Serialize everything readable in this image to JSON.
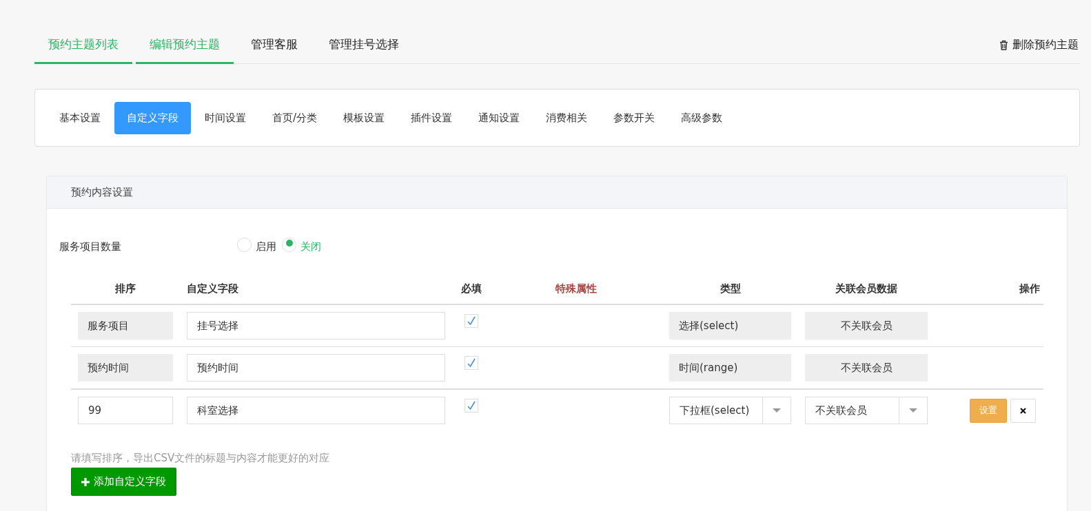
{
  "top_tabs": [
    {
      "label": "预约主题列表",
      "selected": true
    },
    {
      "label": "编辑预约主题",
      "selected": true
    },
    {
      "label": "管理客服",
      "selected": false
    },
    {
      "label": "管理挂号选择",
      "selected": false
    }
  ],
  "delete_link": "删除预约主题",
  "sub_tabs": [
    {
      "label": "基本设置",
      "selected": false
    },
    {
      "label": "自定义字段",
      "selected": true
    },
    {
      "label": "时间设置",
      "selected": false
    },
    {
      "label": "首页/分类",
      "selected": false
    },
    {
      "label": "模板设置",
      "selected": false
    },
    {
      "label": "插件设置",
      "selected": false
    },
    {
      "label": "通知设置",
      "selected": false
    },
    {
      "label": "消费相关",
      "selected": false
    },
    {
      "label": "参数开关",
      "selected": false
    },
    {
      "label": "高级参数",
      "selected": false
    }
  ],
  "panel": {
    "title": "预约内容设置",
    "service_count": {
      "label": "服务项目数量",
      "options": [
        {
          "label": "启用",
          "selected": false
        },
        {
          "label": "关闭",
          "selected": true
        }
      ]
    },
    "table": {
      "columns": [
        "排序",
        "自定义字段",
        "必填",
        "特殊属性",
        "类型",
        "关联会员数据",
        "操作"
      ],
      "rows": [
        {
          "kind": "fixed",
          "order": "服务项目",
          "field": "挂号选择",
          "required": true,
          "type": "选择(select)",
          "member": "不关联会员"
        },
        {
          "kind": "fixed",
          "order": "预约时间",
          "field": "预约时间",
          "required": true,
          "type": "时间(range)",
          "member": "不关联会员"
        },
        {
          "kind": "custom",
          "order": "99",
          "field": "科室选择",
          "required": true,
          "type": "下拉框(select)",
          "member": "不关联会员",
          "action": "设置"
        }
      ]
    },
    "hint": "请填写排序，导出CSV文件的标题与内容才能更好的对应",
    "add_button": "添加自定义字段"
  }
}
